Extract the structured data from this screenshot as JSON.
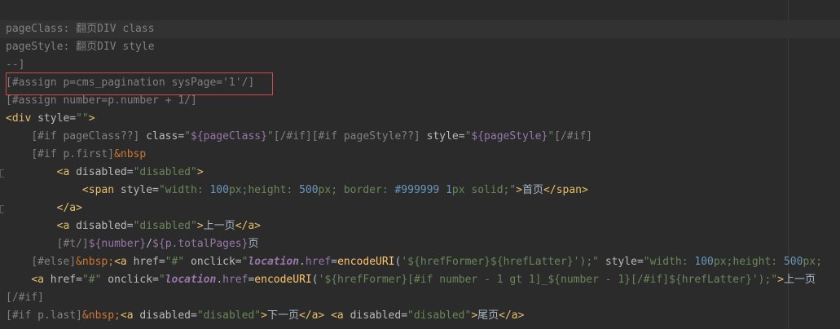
{
  "editor": {
    "lines": [
      [
        {
          "t": "pageClass: 翻页DIV class",
          "c": "cm"
        }
      ],
      [
        {
          "t": "pageStyle: 翻页DIV style",
          "c": "cm"
        }
      ],
      [
        {
          "t": "--]",
          "c": "cm"
        }
      ],
      [
        {
          "t": "[#assign p=cms_pagination sysPage='1'/]",
          "c": "cm"
        }
      ],
      [
        {
          "t": "[#assign number=p.number + 1/]",
          "c": "cm"
        }
      ],
      [
        {
          "t": "<div ",
          "c": "tg"
        },
        {
          "t": "style=",
          "c": "at"
        },
        {
          "t": "\"\"",
          "c": "st"
        },
        {
          "t": ">",
          "c": "tg"
        }
      ],
      [
        {
          "t": "    "
        },
        {
          "t": "[#if pageClass??] ",
          "c": "cm"
        },
        {
          "t": "class=",
          "c": "at"
        },
        {
          "t": "\"",
          "c": "st"
        },
        {
          "t": "${pageClass}",
          "c": "ip"
        },
        {
          "t": "\"",
          "c": "st"
        },
        {
          "t": "[/#if][#if pageStyle??] ",
          "c": "cm"
        },
        {
          "t": "style=",
          "c": "at"
        },
        {
          "t": "\"",
          "c": "st"
        },
        {
          "t": "${pageStyle}",
          "c": "ip"
        },
        {
          "t": "\"",
          "c": "st"
        },
        {
          "t": "[/#if]",
          "c": "cm"
        }
      ],
      [
        {
          "t": "    "
        },
        {
          "t": "[#if p.first]",
          "c": "cm"
        },
        {
          "t": "&nbsp",
          "c": "ent"
        }
      ],
      [
        {
          "t": "        "
        },
        {
          "t": "<a ",
          "c": "tg"
        },
        {
          "t": "disabled=",
          "c": "at"
        },
        {
          "t": "\"disabled\"",
          "c": "st"
        },
        {
          "t": ">",
          "c": "tg"
        }
      ],
      [
        {
          "t": "            "
        },
        {
          "t": "<span ",
          "c": "tg"
        },
        {
          "t": "style=",
          "c": "at"
        },
        {
          "t": "\"width: ",
          "c": "st"
        },
        {
          "t": "100",
          "c": "nm"
        },
        {
          "t": "px;height: ",
          "c": "st"
        },
        {
          "t": "500",
          "c": "nm"
        },
        {
          "t": "px; border: ",
          "c": "st"
        },
        {
          "t": "#999999 1",
          "c": "nm"
        },
        {
          "t": "px solid;\"",
          "c": "st"
        },
        {
          "t": ">",
          "c": "tg"
        },
        {
          "t": "首页"
        },
        {
          "t": "</span>",
          "c": "tg"
        }
      ],
      [
        {
          "t": "        "
        },
        {
          "t": "</a>",
          "c": "tg"
        }
      ],
      [
        {
          "t": "        "
        },
        {
          "t": "<a ",
          "c": "tg"
        },
        {
          "t": "disabled=",
          "c": "at"
        },
        {
          "t": "\"disabled\"",
          "c": "st"
        },
        {
          "t": ">",
          "c": "tg"
        },
        {
          "t": "上一页"
        },
        {
          "t": "</a>",
          "c": "tg"
        }
      ],
      [
        {
          "t": "        "
        },
        {
          "t": "[#t/]",
          "c": "cm"
        },
        {
          "t": "${number}",
          "c": "ip"
        },
        {
          "t": "/"
        },
        {
          "t": "${p.totalPages}",
          "c": "ip"
        },
        {
          "t": "页"
        }
      ],
      [
        {
          "t": "    "
        },
        {
          "t": "[#else]",
          "c": "cm"
        },
        {
          "t": "&nbsp;",
          "c": "ent"
        },
        {
          "t": "<a ",
          "c": "tg"
        },
        {
          "t": "href=",
          "c": "at"
        },
        {
          "t": "\"#\" ",
          "c": "st"
        },
        {
          "t": "onclick=",
          "c": "at"
        },
        {
          "t": "\"",
          "c": "st"
        },
        {
          "t": "location",
          "c": "it"
        },
        {
          "t": "."
        },
        {
          "t": "href",
          "c": "ip"
        },
        {
          "t": "="
        },
        {
          "t": "encodeURI",
          "c": "fn"
        },
        {
          "t": "("
        },
        {
          "t": "'${hrefFormer}${hrefLatter}'",
          "c": "st"
        },
        {
          "t": ");\" ",
          "c": "st"
        },
        {
          "t": "style=",
          "c": "at"
        },
        {
          "t": "\"width: ",
          "c": "st"
        },
        {
          "t": "100",
          "c": "nm"
        },
        {
          "t": "px;height: ",
          "c": "st"
        },
        {
          "t": "500",
          "c": "nm"
        },
        {
          "t": "px;",
          "c": "st"
        }
      ],
      [
        {
          "t": "    "
        },
        {
          "t": "<a ",
          "c": "tg"
        },
        {
          "t": "href=",
          "c": "at"
        },
        {
          "t": "\"#\" ",
          "c": "st"
        },
        {
          "t": "onclick=",
          "c": "at"
        },
        {
          "t": "\"",
          "c": "st"
        },
        {
          "t": "location",
          "c": "it"
        },
        {
          "t": "."
        },
        {
          "t": "href",
          "c": "ip"
        },
        {
          "t": "="
        },
        {
          "t": "encodeURI",
          "c": "fn"
        },
        {
          "t": "("
        },
        {
          "t": "'${hrefFormer}[#if number - 1 gt 1]_${number - 1}[/#if]${hrefLatter}'",
          "c": "st"
        },
        {
          "t": ");\"",
          "c": "st"
        },
        {
          "t": ">",
          "c": "tg"
        },
        {
          "t": "上一页"
        }
      ],
      [
        {
          "t": "[/#if]",
          "c": "cm"
        }
      ],
      [
        {
          "t": "[#if p.last]",
          "c": "cm"
        },
        {
          "t": "&nbsp;",
          "c": "ent"
        },
        {
          "t": "<a ",
          "c": "tg"
        },
        {
          "t": "disabled=",
          "c": "at"
        },
        {
          "t": "\"disabled\"",
          "c": "st"
        },
        {
          "t": ">",
          "c": "tg"
        },
        {
          "t": "下一页"
        },
        {
          "t": "</a> ",
          "c": "tg"
        },
        {
          "t": "<a ",
          "c": "tg"
        },
        {
          "t": "disabled=",
          "c": "at"
        },
        {
          "t": "\"disabled\"",
          "c": "st"
        },
        {
          "t": ">",
          "c": "tg"
        },
        {
          "t": "尾页"
        },
        {
          "t": "</a>",
          "c": "tg"
        }
      ]
    ]
  }
}
